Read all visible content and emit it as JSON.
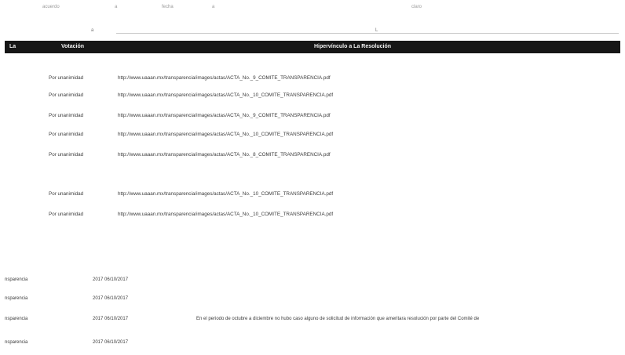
{
  "top": {
    "c1": "acuerdo",
    "c2": "a",
    "c3": "fecha",
    "c4": "a",
    "c5": "claro"
  },
  "rule_mark_left": "a",
  "rule_mark_right": "L",
  "table_header": {
    "col1": "La",
    "col2": "Votación",
    "col3": "Hipervínculo a La Resolución"
  },
  "rows": [
    {
      "vote": "Por unanimidad",
      "url": "http://www.uaaan.mx/transparencia/images/actas/ACTA_No._9_COMITE_TRANSPARENCIA.pdf"
    },
    {
      "vote": "Por unanimidad",
      "url": "http://www.uaaan.mx/transparencia/images/actas/ACTA_No._10_COMITE_TRANSPARENCIA.pdf"
    },
    {
      "vote": "Por unanimidad",
      "url": "http://www.uaaan.mx/transparencia/images/actas/ACTA_No._9_COMITE_TRANSPARENCIA.pdf"
    },
    {
      "vote": "Por unanimidad",
      "url": "http://www.uaaan.mx/transparencia/images/actas/ACTA_No._10_COMITE_TRANSPARENCIA.pdf"
    },
    {
      "vote": "Por unanimidad",
      "url": "http://www.uaaan.mx/transparencia/images/actas/ACTA_No._8_COMITE_TRANSPARENCIA.pdf"
    },
    {
      "vote": "Por unanimidad",
      "url": "http://www.uaaan.mx/transparencia/images/actas/ACTA_No._10_COMITE_TRANSPARENCIA.pdf"
    },
    {
      "vote": "Por unanimidad",
      "url": "http://www.uaaan.mx/transparencia/images/actas/ACTA_No._10_COMITE_TRANSPARENCIA.pdf"
    }
  ],
  "lower_rows": [
    {
      "label": "nsparencia",
      "date": "2017  06/10/2017",
      "note": ""
    },
    {
      "label": "nsparencia",
      "date": "2017  06/10/2017",
      "note": ""
    },
    {
      "label": "nsparencia",
      "date": "2017  06/10/2017",
      "note": "En el periodo de octubre a diciembre no hubo caso alguno de solicitud de información  que ameritara resolución por parte del Comité de"
    },
    {
      "label": "nsparencia",
      "date": "2017  06/10/2017",
      "note": ""
    }
  ]
}
